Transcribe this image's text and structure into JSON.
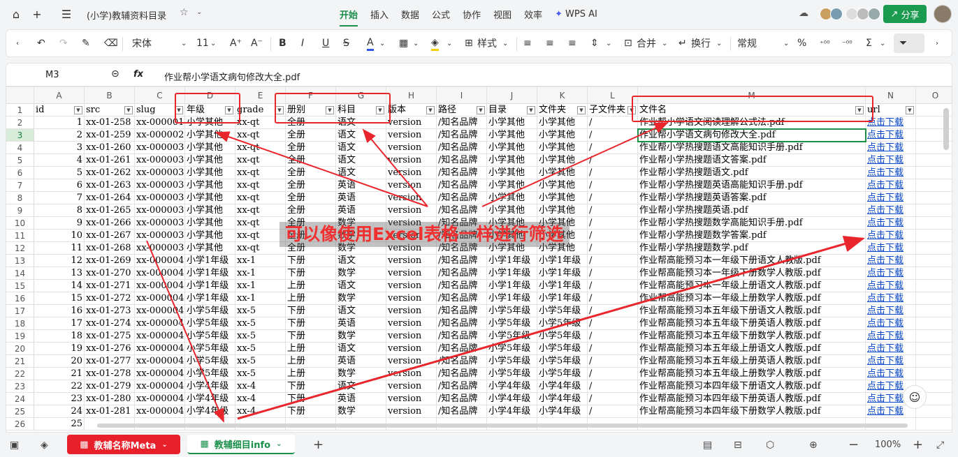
{
  "window": {
    "title": "(小学)教辅资料目录"
  },
  "menus": [
    "开始",
    "插入",
    "数据",
    "公式",
    "协作",
    "视图",
    "效率"
  ],
  "wps_ai": "WPS AI",
  "share": "分享",
  "toolbar": {
    "font": "宋体",
    "size": "11",
    "style": "样式",
    "merge": "合并",
    "wrap": "换行",
    "format": "常规"
  },
  "formula": {
    "cell": "M3",
    "fx": "fx",
    "value": "作业帮小学语文病句修改大全.pdf"
  },
  "columns": [
    {
      "letter": "A"
    },
    {
      "letter": "B"
    },
    {
      "letter": "C"
    },
    {
      "letter": "D"
    },
    {
      "letter": "E"
    },
    {
      "letter": "F"
    },
    {
      "letter": "G"
    },
    {
      "letter": "H"
    },
    {
      "letter": "I"
    },
    {
      "letter": "J"
    },
    {
      "letter": "K"
    },
    {
      "letter": "L"
    },
    {
      "letter": "M"
    },
    {
      "letter": "N"
    },
    {
      "letter": "O"
    }
  ],
  "headers": [
    "id",
    "src",
    "slug",
    "年级",
    "grade",
    "册别",
    "科目",
    "版本",
    "路径",
    "目录",
    "文件夹",
    "子文件夹",
    "文件名",
    "url"
  ],
  "rows": [
    [
      "1",
      "xx-01-258",
      "xx-000001",
      "小学其他",
      "xx-qt",
      "全册",
      "语文",
      "version",
      "/知名品牌",
      "小学其他",
      "小学其他",
      "/",
      "作业帮小学语文阅读理解公式法.pdf",
      "点击下载"
    ],
    [
      "2",
      "xx-01-259",
      "xx-000002",
      "小学其他",
      "xx-qt",
      "全册",
      "语文",
      "version",
      "/知名品牌",
      "小学其他",
      "小学其他",
      "/",
      "作业帮小学语文病句修改大全.pdf",
      "点击下载"
    ],
    [
      "3",
      "xx-01-260",
      "xx-000003",
      "小学其他",
      "xx-qt",
      "全册",
      "语文",
      "version",
      "/知名品牌",
      "小学其他",
      "小学其他",
      "/",
      "作业帮小学热搜题语文高能知识手册.pdf",
      "点击下载"
    ],
    [
      "4",
      "xx-01-261",
      "xx-000003",
      "小学其他",
      "xx-qt",
      "全册",
      "语文",
      "version",
      "/知名品牌",
      "小学其他",
      "小学其他",
      "/",
      "作业帮小学热搜题语文答案.pdf",
      "点击下载"
    ],
    [
      "5",
      "xx-01-262",
      "xx-000003",
      "小学其他",
      "xx-qt",
      "全册",
      "语文",
      "version",
      "/知名品牌",
      "小学其他",
      "小学其他",
      "/",
      "作业帮小学热搜题语文.pdf",
      "点击下载"
    ],
    [
      "6",
      "xx-01-263",
      "xx-000003",
      "小学其他",
      "xx-qt",
      "全册",
      "英语",
      "version",
      "/知名品牌",
      "小学其他",
      "小学其他",
      "/",
      "作业帮小学热搜题英语高能知识手册.pdf",
      "点击下载"
    ],
    [
      "7",
      "xx-01-264",
      "xx-000003",
      "小学其他",
      "xx-qt",
      "全册",
      "英语",
      "version",
      "/知名品牌",
      "小学其他",
      "小学其他",
      "/",
      "作业帮小学热搜题英语答案.pdf",
      "点击下载"
    ],
    [
      "8",
      "xx-01-265",
      "xx-000003",
      "小学其他",
      "xx-qt",
      "全册",
      "英语",
      "version",
      "/知名品牌",
      "小学其他",
      "小学其他",
      "/",
      "作业帮小学热搜题英语.pdf",
      "点击下载"
    ],
    [
      "9",
      "xx-01-266",
      "xx-000003",
      "小学其他",
      "xx-qt",
      "全册",
      "数学",
      "version",
      "/知名品牌",
      "小学其他",
      "小学其他",
      "/",
      "作业帮小学热搜题数学高能知识手册.pdf",
      "点击下载"
    ],
    [
      "10",
      "xx-01-267",
      "xx-000003",
      "小学其他",
      "xx-qt",
      "全册",
      "数学",
      "version",
      "/知名品牌",
      "小学其他",
      "小学其他",
      "/",
      "作业帮小学热搜题数学答案.pdf",
      "点击下载"
    ],
    [
      "11",
      "xx-01-268",
      "xx-000003",
      "小学其他",
      "xx-qt",
      "全册",
      "数学",
      "version",
      "/知名品牌",
      "小学其他",
      "小学其他",
      "/",
      "作业帮小学热搜题数学.pdf",
      "点击下载"
    ],
    [
      "12",
      "xx-01-269",
      "xx-000004",
      "小学1年级",
      "xx-1",
      "下册",
      "语文",
      "version",
      "/知名品牌",
      "小学1年级",
      "小学1年级",
      "/",
      "作业帮高能预习本一年级下册语文人教版.pdf",
      "点击下载"
    ],
    [
      "13",
      "xx-01-270",
      "xx-000004",
      "小学1年级",
      "xx-1",
      "下册",
      "数学",
      "version",
      "/知名品牌",
      "小学1年级",
      "小学1年级",
      "/",
      "作业帮高能预习本一年级下册数学人教版.pdf",
      "点击下载"
    ],
    [
      "14",
      "xx-01-271",
      "xx-000004",
      "小学1年级",
      "xx-1",
      "上册",
      "语文",
      "version",
      "/知名品牌",
      "小学1年级",
      "小学1年级",
      "/",
      "作业帮高能预习本一年级上册语文人教版.pdf",
      "点击下载"
    ],
    [
      "15",
      "xx-01-272",
      "xx-000004",
      "小学1年级",
      "xx-1",
      "上册",
      "数学",
      "version",
      "/知名品牌",
      "小学1年级",
      "小学1年级",
      "/",
      "作业帮高能预习本一年级上册数学人教版.pdf",
      "点击下载"
    ],
    [
      "16",
      "xx-01-273",
      "xx-000004",
      "小学5年级",
      "xx-5",
      "下册",
      "语文",
      "version",
      "/知名品牌",
      "小学5年级",
      "小学5年级",
      "/",
      "作业帮高能预习本五年级下册语文人教版.pdf",
      "点击下载"
    ],
    [
      "17",
      "xx-01-274",
      "xx-000004",
      "小学5年级",
      "xx-5",
      "下册",
      "英语",
      "version",
      "/知名品牌",
      "小学5年级",
      "小学5年级",
      "/",
      "作业帮高能预习本五年级下册英语人教版.pdf",
      "点击下载"
    ],
    [
      "18",
      "xx-01-275",
      "xx-000004",
      "小学5年级",
      "xx-5",
      "下册",
      "数学",
      "version",
      "/知名品牌",
      "小学5年级",
      "小学5年级",
      "/",
      "作业帮高能预习本五年级下册数学人教版.pdf",
      "点击下载"
    ],
    [
      "19",
      "xx-01-276",
      "xx-000004",
      "小学5年级",
      "xx-5",
      "上册",
      "语文",
      "version",
      "/知名品牌",
      "小学5年级",
      "小学5年级",
      "/",
      "作业帮高能预习本五年级上册语文人教版.pdf",
      "点击下载"
    ],
    [
      "20",
      "xx-01-277",
      "xx-000004",
      "小学5年级",
      "xx-5",
      "上册",
      "英语",
      "version",
      "/知名品牌",
      "小学5年级",
      "小学5年级",
      "/",
      "作业帮高能预习本五年级上册英语人教版.pdf",
      "点击下载"
    ],
    [
      "21",
      "xx-01-278",
      "xx-000004",
      "小学5年级",
      "xx-5",
      "上册",
      "数学",
      "version",
      "/知名品牌",
      "小学5年级",
      "小学5年级",
      "/",
      "作业帮高能预习本五年级上册数学人教版.pdf",
      "点击下载"
    ],
    [
      "22",
      "xx-01-279",
      "xx-000004",
      "小学4年级",
      "xx-4",
      "下册",
      "语文",
      "version",
      "/知名品牌",
      "小学4年级",
      "小学4年级",
      "/",
      "作业帮高能预习本四年级下册语文人教版.pdf",
      "点击下载"
    ],
    [
      "23",
      "xx-01-280",
      "xx-000004",
      "小学4年级",
      "xx-4",
      "下册",
      "英语",
      "version",
      "/知名品牌",
      "小学4年级",
      "小学4年级",
      "/",
      "作业帮高能预习本四年级下册英语人教版.pdf",
      "点击下载"
    ],
    [
      "24",
      "xx-01-281",
      "xx-000004",
      "小学4年级",
      "xx-4",
      "下册",
      "数学",
      "version",
      "/知名品牌",
      "小学4年级",
      "小学4年级",
      "/",
      "作业帮高能预习本四年级下册数学人教版.pdf",
      "点击下载"
    ],
    [
      "25",
      "",
      "",
      "",
      "",
      "",
      "",
      "",
      "",
      "",
      "",
      "",
      "",
      ""
    ]
  ],
  "annotation": "可以像使用Excel表格一样进行筛选",
  "sheets": [
    {
      "label": "教辅名称Meta"
    },
    {
      "label": "教辅细目info"
    }
  ],
  "zoom": "100%"
}
